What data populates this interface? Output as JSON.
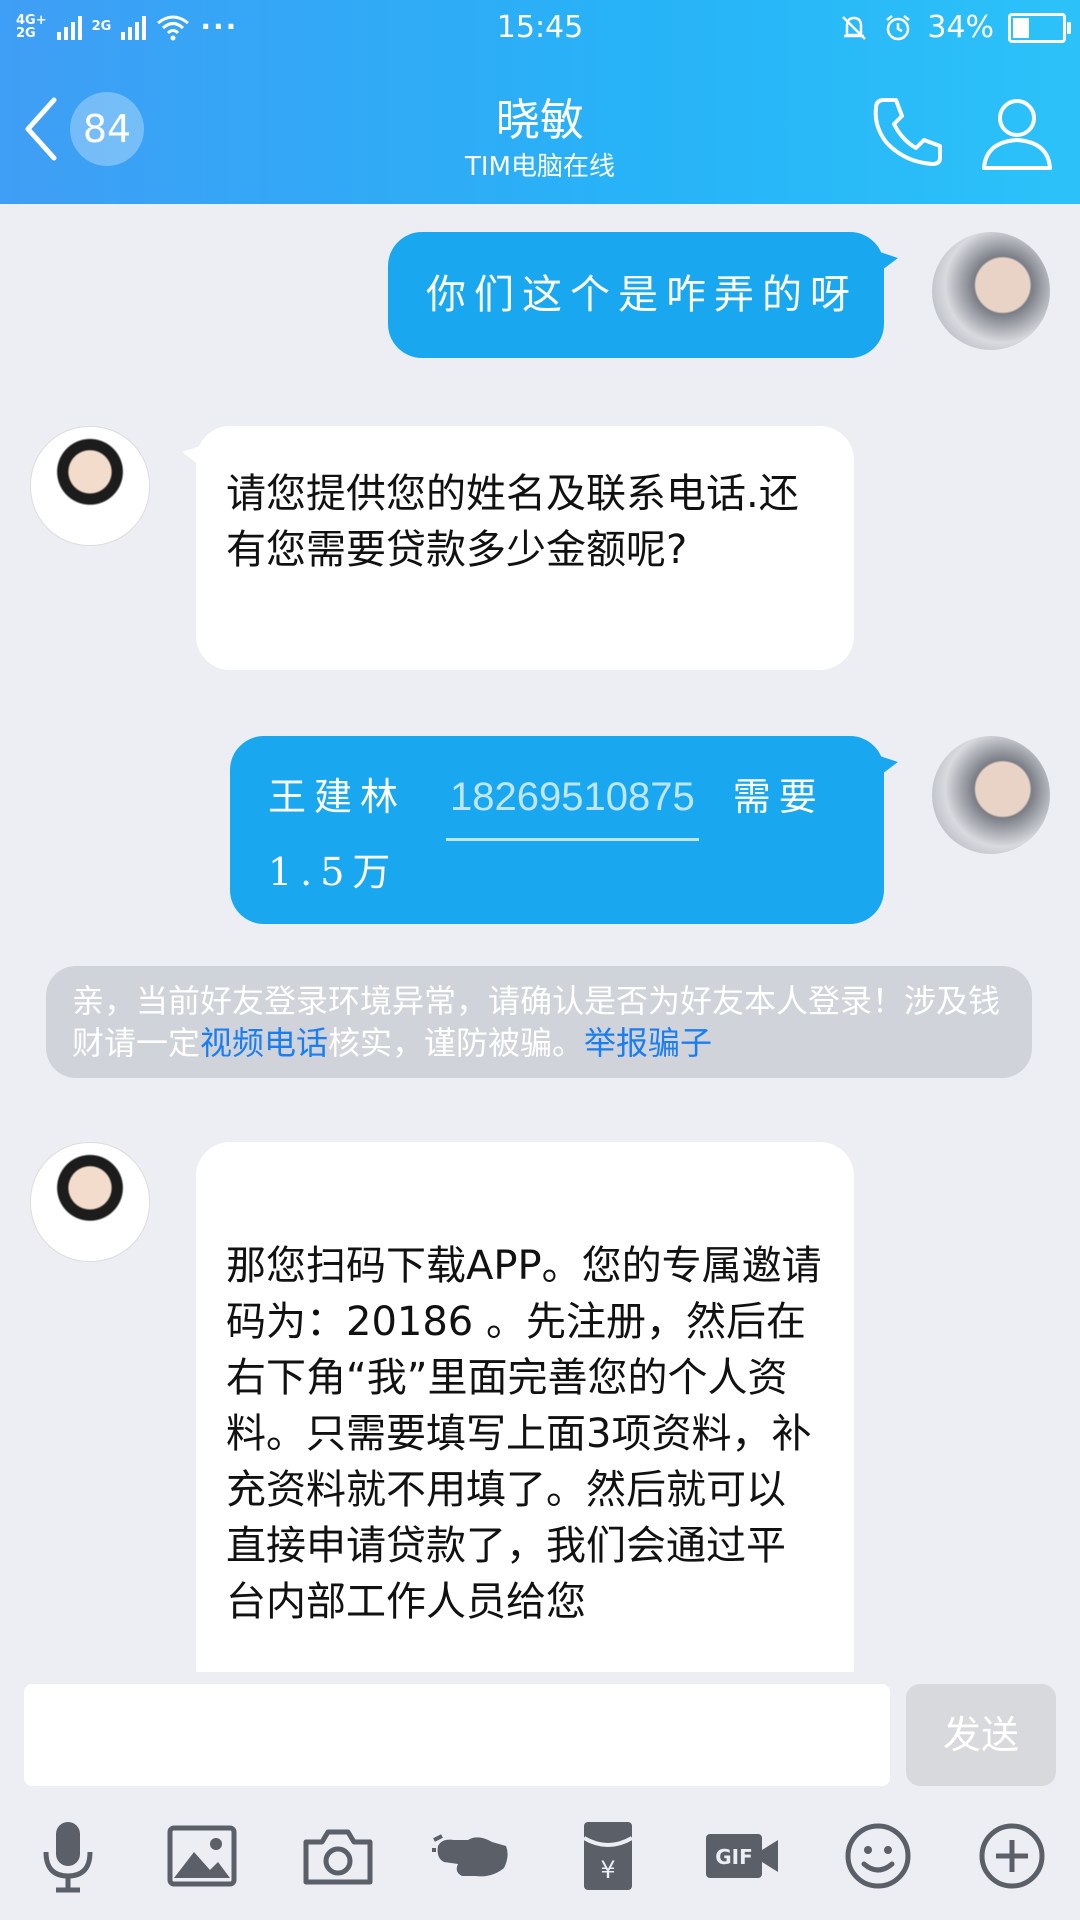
{
  "status_bar": {
    "network_a": "4G+",
    "network_b": "2G",
    "network_c": "2G",
    "more": "···",
    "time": "15:45",
    "battery_text": "34%",
    "battery_level": 0.34
  },
  "header": {
    "unread_count": "84",
    "contact_name": "晓敏",
    "contact_status": "TIM电脑在线"
  },
  "messages": {
    "m1": {
      "text": "你们这个是咋弄的呀"
    },
    "m2": {
      "text": "请您提供您的姓名及联系电话.还有您需要贷款多少金额呢?"
    },
    "m3": {
      "name": "王建林",
      "phone": "18269510875",
      "tail": "需要",
      "line2": "1.5万"
    },
    "warning": {
      "text1": "亲，当前好友登录环境异常，请确认是否为好友本人登录！涉及钱财请一定",
      "link1": "视频电话",
      "text2": "核实，谨防被骗。",
      "link2": "举报骗子"
    },
    "m4": {
      "text": "那您扫码下载APP。您的专属邀请码为：20186 。先注册，然后在右下角“我”里面完善您的个人资料。只需要填写上面3项资料，补充资料就不用填了。然后就可以直接申请贷款了，我们会通过平台内部工作人员给您"
    }
  },
  "input": {
    "send_label": "发送"
  },
  "toolbar": {
    "icons": [
      "microphone-icon",
      "image-icon",
      "camera-icon",
      "poke-hand-icon",
      "red-packet-icon",
      "gif-icon",
      "emoji-icon",
      "plus-icon"
    ]
  },
  "colors": {
    "header_start": "#3f9ef5",
    "header_end": "#2cc2f9",
    "my_bubble": "#19a8f0",
    "link": "#1a7ef0"
  }
}
